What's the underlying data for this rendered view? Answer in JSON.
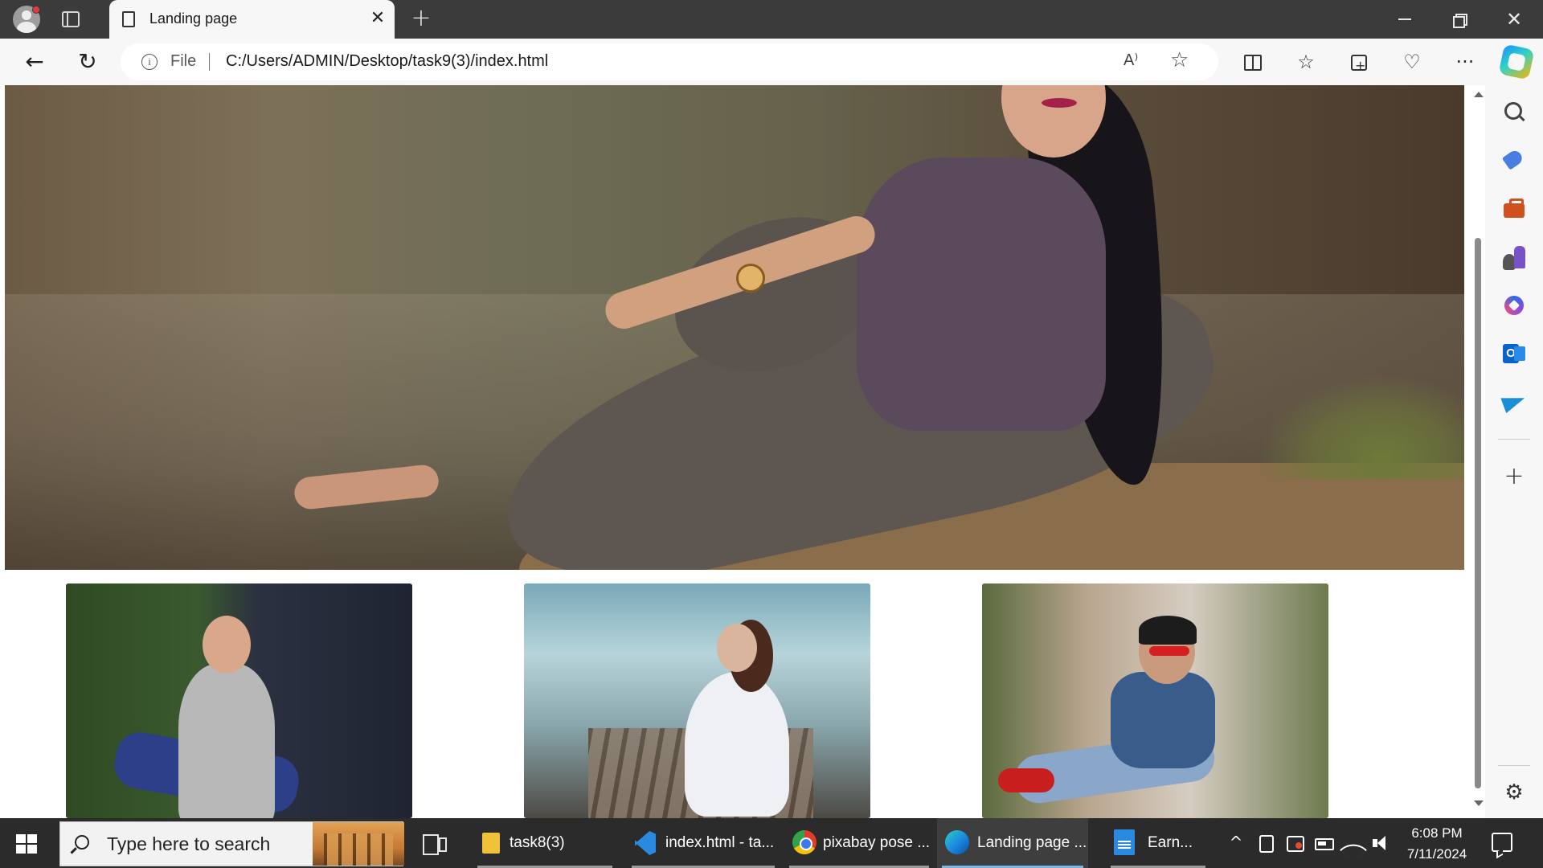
{
  "browser": {
    "tab": {
      "title": "Landing page",
      "close_glyph": "✕"
    },
    "new_tab_glyph": "+",
    "window_close_glyph": "✕",
    "nav": {
      "back_glyph": "←",
      "reload_glyph": "↻"
    },
    "address": {
      "info_glyph": "i",
      "scheme": "File",
      "url": "C:/Users/ADMIN/Desktop/task9(3)/index.html",
      "read_aloud_glyph": "A⁾",
      "favorite_glyph": "☆"
    },
    "toolbar_icons": {
      "favorites_glyph": "☆",
      "more_glyph": "···"
    },
    "sidebar": {
      "add_glyph": "+",
      "settings_glyph": "⚙"
    }
  },
  "page": {
    "hero": {
      "icon": "hero-photo"
    },
    "thumbnails": [
      {
        "icon": "man-photo"
      },
      {
        "icon": "woman-photo"
      },
      {
        "icon": "boy-photo"
      }
    ]
  },
  "taskbar": {
    "search_placeholder": "Type here to search",
    "apps": [
      {
        "label": "task8(3)",
        "icon": "folder-icon"
      },
      {
        "label": "index.html - ta...",
        "icon": "vscode-icon"
      },
      {
        "label": "pixabay pose ...",
        "icon": "chrome-icon"
      },
      {
        "label": "Landing page ...",
        "icon": "edge-icon",
        "active": true
      },
      {
        "label": "Earn...",
        "icon": "word-icon"
      }
    ],
    "tray": {
      "chevron_glyph": "^"
    },
    "clock": {
      "time": "6:08 PM",
      "date": "7/11/2024"
    }
  },
  "colors": {
    "titlebar": "#3b3b3b",
    "toolbar": "#f7f7f7",
    "taskbar": "#2b2b2b",
    "active_indicator": "#7cb4e8"
  }
}
